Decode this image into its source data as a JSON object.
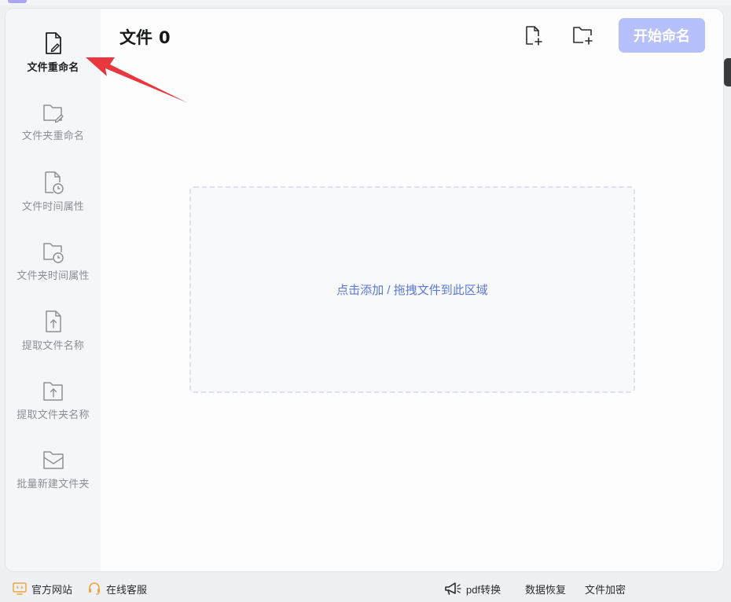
{
  "header": {
    "title": "文件",
    "file_count": "0",
    "start_button": "开始命名"
  },
  "sidebar": {
    "items": [
      {
        "label": "文件重命名",
        "icon": "file-edit-icon",
        "active": true
      },
      {
        "label": "文件夹重命名",
        "icon": "folder-edit-icon",
        "active": false
      },
      {
        "label": "文件时间属性",
        "icon": "file-clock-icon",
        "active": false
      },
      {
        "label": "文件夹时间属性",
        "icon": "folder-clock-icon",
        "active": false
      },
      {
        "label": "提取文件名称",
        "icon": "file-upload-icon",
        "active": false
      },
      {
        "label": "提取文件夹名称",
        "icon": "folder-upload-icon",
        "active": false
      },
      {
        "label": "批量新建文件夹",
        "icon": "folder-mail-icon",
        "active": false
      }
    ]
  },
  "dropzone": {
    "text": "点击添加 / 拖拽文件到此区域"
  },
  "footer": {
    "website": "官方网站",
    "support": "在线客服",
    "pdf": "pdf转换",
    "recovery": "数据恢复",
    "encrypt": "文件加密"
  },
  "colors": {
    "accent": "#b6c1fb",
    "link": "#5b79d6",
    "arrow": "#e8383d",
    "sidebar_bg": "#f5f6f9"
  }
}
